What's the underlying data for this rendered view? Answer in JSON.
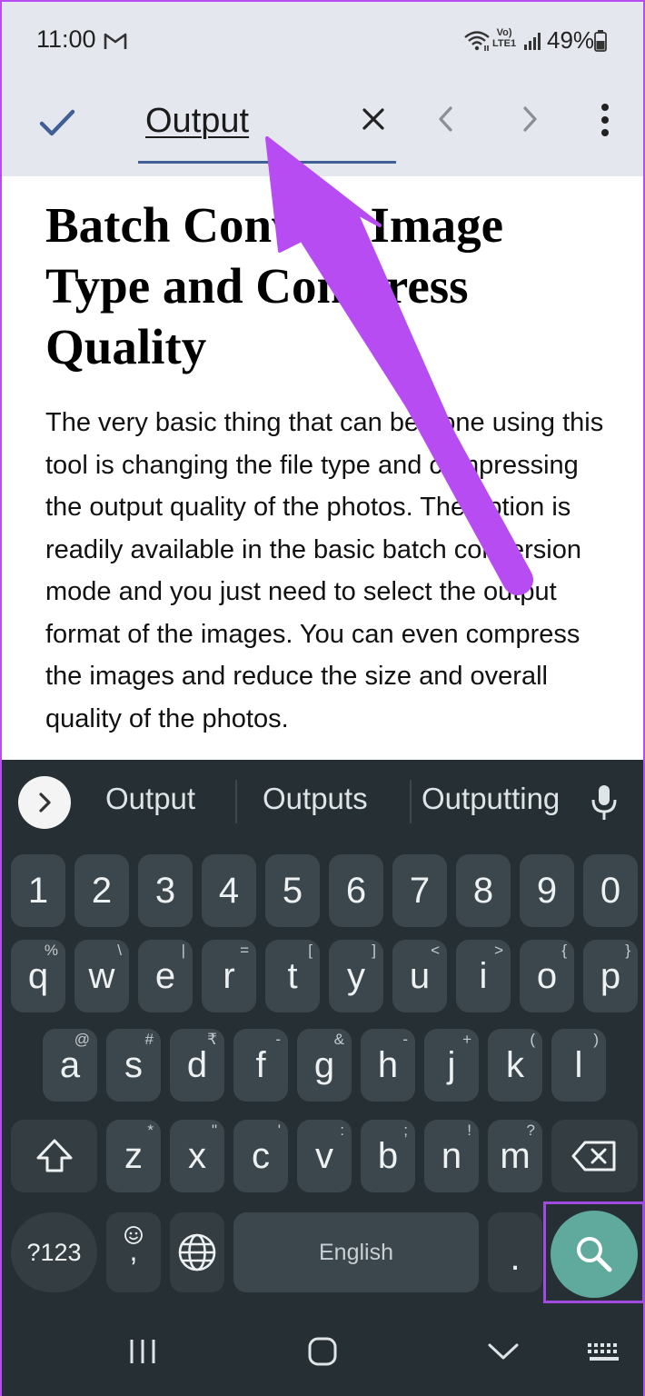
{
  "status_bar": {
    "time": "11:00",
    "volte_line1": "Vo)",
    "volte_line2": "LTE1",
    "battery": "49%"
  },
  "find_bar": {
    "query": "Output",
    "icons": [
      "check-icon",
      "clear-icon",
      "chevron-left-icon",
      "chevron-right-icon",
      "more-vert-icon"
    ]
  },
  "document": {
    "title": "Batch Convert Image Type and Compress Quality",
    "body": "The very basic thing that can be done using this tool is changing the file type and compressing the output quality of the photos. The option is readily available in the basic batch conversion mode and you just need to select the output format of the images. You can even compress the images and reduce the size and overall quality of the photos."
  },
  "keyboard": {
    "suggestions": [
      "Output",
      "Outputs",
      "Outputting"
    ],
    "number_row": [
      "1",
      "2",
      "3",
      "4",
      "5",
      "6",
      "7",
      "8",
      "9",
      "0"
    ],
    "row1": [
      {
        "key": "q",
        "hint": "%"
      },
      {
        "key": "w",
        "hint": "\\"
      },
      {
        "key": "e",
        "hint": "|"
      },
      {
        "key": "r",
        "hint": "="
      },
      {
        "key": "t",
        "hint": "["
      },
      {
        "key": "y",
        "hint": "]"
      },
      {
        "key": "u",
        "hint": "<"
      },
      {
        "key": "i",
        "hint": ">"
      },
      {
        "key": "o",
        "hint": "{"
      },
      {
        "key": "p",
        "hint": "}"
      }
    ],
    "row2": [
      {
        "key": "a",
        "hint": "@"
      },
      {
        "key": "s",
        "hint": "#"
      },
      {
        "key": "d",
        "hint": "₹"
      },
      {
        "key": "f",
        "hint": "-"
      },
      {
        "key": "g",
        "hint": "&"
      },
      {
        "key": "h",
        "hint": "-"
      },
      {
        "key": "j",
        "hint": "+"
      },
      {
        "key": "k",
        "hint": "("
      },
      {
        "key": "l",
        "hint": ")"
      }
    ],
    "row3": [
      {
        "key": "z",
        "hint": "*"
      },
      {
        "key": "x",
        "hint": "\""
      },
      {
        "key": "c",
        "hint": "'"
      },
      {
        "key": "v",
        "hint": ":"
      },
      {
        "key": "b",
        "hint": ";"
      },
      {
        "key": "n",
        "hint": "!"
      },
      {
        "key": "m",
        "hint": "?"
      }
    ],
    "symbols_label": "?123",
    "comma_label": ",",
    "space_label": "English",
    "period_label": "."
  },
  "colors": {
    "accent": "#3f5f95",
    "keyboard_bg": "#262f34",
    "key_bg": "#3c474d",
    "search_key": "#60a99d",
    "annotation": "#b64cf2"
  }
}
